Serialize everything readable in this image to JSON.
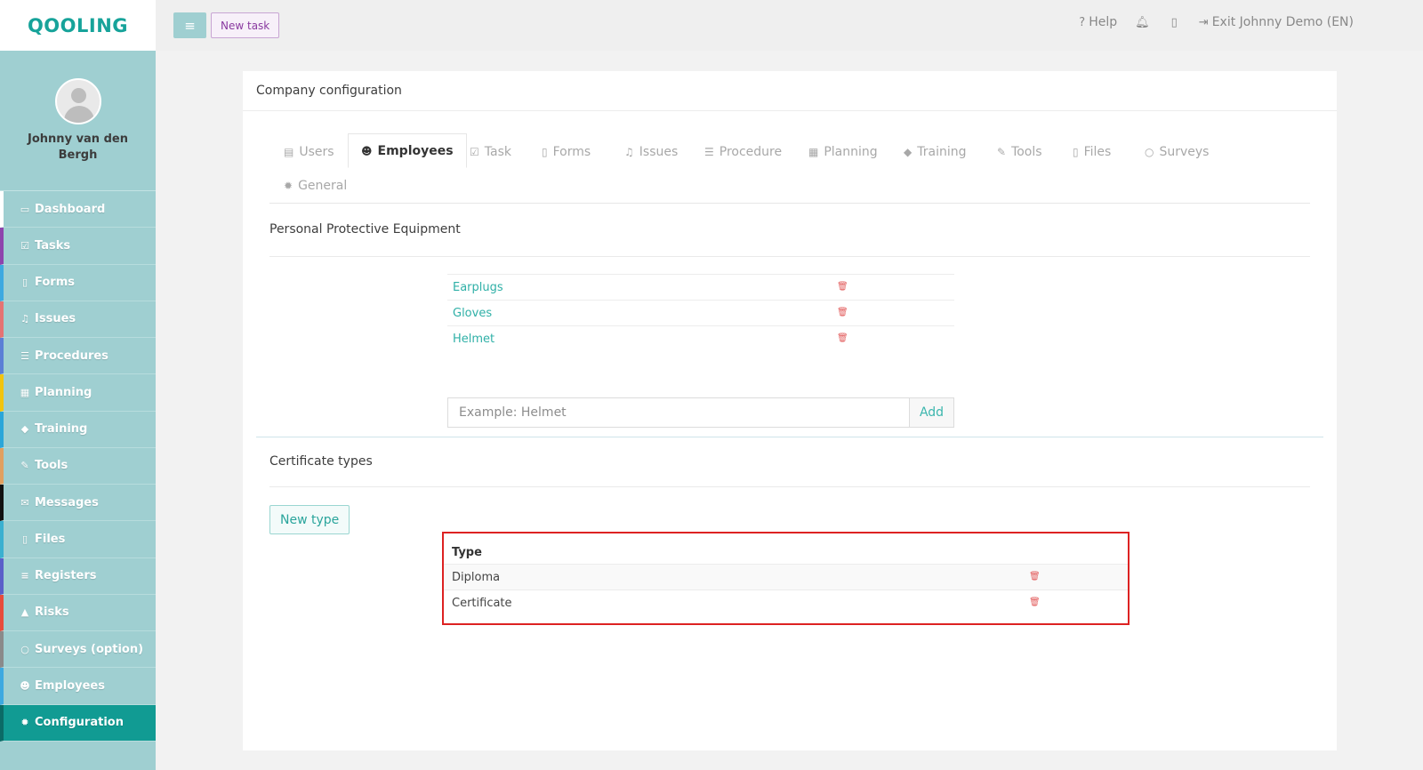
{
  "brand": {
    "logo": "QOOLING"
  },
  "user": {
    "name": "Johnny van den Bergh"
  },
  "sidebar": {
    "items": [
      {
        "label": "Dashboard",
        "icon": "monitor-icon",
        "accent": "#ffffff"
      },
      {
        "label": "Tasks",
        "icon": "check-square-icon",
        "accent": "#8e44ad"
      },
      {
        "label": "Forms",
        "icon": "file-icon",
        "accent": "#3da9e0"
      },
      {
        "label": "Issues",
        "icon": "bell-icon",
        "accent": "#e57373"
      },
      {
        "label": "Procedures",
        "icon": "list-alt-icon",
        "accent": "#5b7fd6"
      },
      {
        "label": "Planning",
        "icon": "calendar-icon",
        "accent": "#f1c40f"
      },
      {
        "label": "Training",
        "icon": "graduation-cap-icon",
        "accent": "#2aa6d9"
      },
      {
        "label": "Tools",
        "icon": "wrench-icon",
        "accent": "#e0a060"
      },
      {
        "label": "Messages",
        "icon": "envelope-icon",
        "accent": "#111111"
      },
      {
        "label": "Files",
        "icon": "file-pdf-icon",
        "accent": "#3ab0d0"
      },
      {
        "label": "Registers",
        "icon": "list-icon",
        "accent": "#5a5fc9"
      },
      {
        "label": "Risks",
        "icon": "warning-icon",
        "accent": "#e74c3c"
      },
      {
        "label": "Surveys (option)",
        "icon": "comment-icon",
        "accent": "#8a8a8a"
      },
      {
        "label": "Employees",
        "icon": "users-icon",
        "accent": "#3da9e0"
      },
      {
        "label": "Configuration",
        "icon": "cog-icon",
        "accent": "#0b6b66"
      }
    ],
    "active_index": 14
  },
  "topbar": {
    "new_task_label": "New task",
    "help_label": "Help",
    "exit_label": "Exit Johnny Demo (EN)"
  },
  "panel": {
    "title": "Company configuration",
    "tabs": [
      {
        "label": "Users",
        "icon": "id-card-icon"
      },
      {
        "label": "Employees",
        "icon": "users-icon"
      },
      {
        "label": "Task",
        "icon": "check-square-icon"
      },
      {
        "label": "Forms",
        "icon": "file-icon"
      },
      {
        "label": "Issues",
        "icon": "bell-icon"
      },
      {
        "label": "Procedure",
        "icon": "list-alt-icon"
      },
      {
        "label": "Planning",
        "icon": "calendar-icon"
      },
      {
        "label": "Training",
        "icon": "graduation-cap-icon"
      },
      {
        "label": "Tools",
        "icon": "wrench-icon"
      },
      {
        "label": "Files",
        "icon": "file-icon"
      },
      {
        "label": "Surveys",
        "icon": "comment-icon"
      },
      {
        "label": "General",
        "icon": "cog-icon"
      }
    ],
    "active_tab": "Employees",
    "ppe": {
      "title": "Personal Protective Equipment",
      "items": [
        "Earplugs",
        "Gloves",
        "Helmet"
      ],
      "input_placeholder": "Example: Helmet",
      "input_value": "",
      "add_label": "Add"
    },
    "certificates": {
      "title": "Certificate types",
      "new_type_label": "New type",
      "column_header": "Type",
      "rows": [
        "Diploma",
        "Certificate"
      ]
    }
  },
  "colors": {
    "brand": "#17a39a",
    "sidebar_bg": "#9fcfd1",
    "sidebar_active": "#119b93",
    "link": "#2fb0a7",
    "delete": "#e25b5b",
    "highlight_border": "#dd2222"
  }
}
